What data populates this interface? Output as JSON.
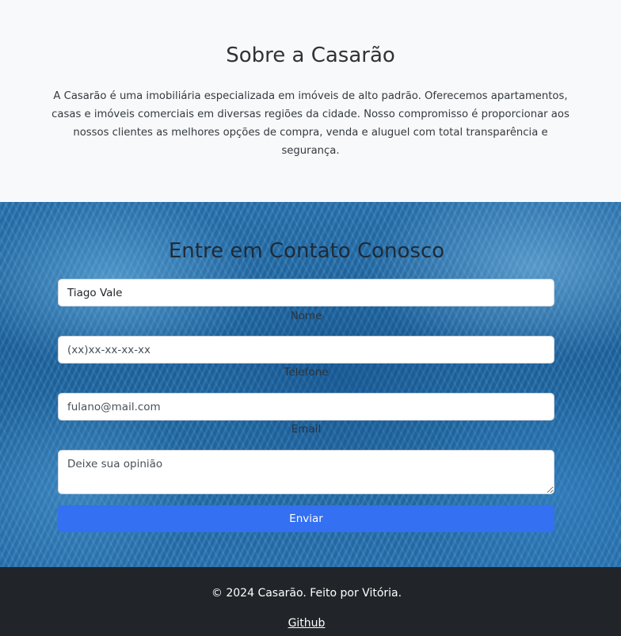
{
  "about": {
    "title": "Sobre a Casarão",
    "text": "A Casarão é uma imobiliária especializada em imóveis de alto padrão. Oferecemos apartamentos, casas e imóveis comerciais em diversas regiões da cidade. Nosso compromisso é proporcionar aos nossos clientes as melhores opções de compra, venda e aluguel com total transparência e segurança."
  },
  "contact": {
    "title": "Entre em Contato Conosco",
    "name_value": "Tiago Vale",
    "name_label": "Nome",
    "phone_placeholder": "(xx)xx-xx-xx-xx",
    "phone_label": "Telefone",
    "email_placeholder": "fulano@mail.com",
    "email_label": "Email",
    "message_placeholder": "Deixe sua opinião",
    "submit_label": "Enviar",
    "button_color": "#3370f2"
  },
  "footer": {
    "copyright": "© 2024 Casarão. Feito por Vitória.",
    "github_link": "Github"
  }
}
